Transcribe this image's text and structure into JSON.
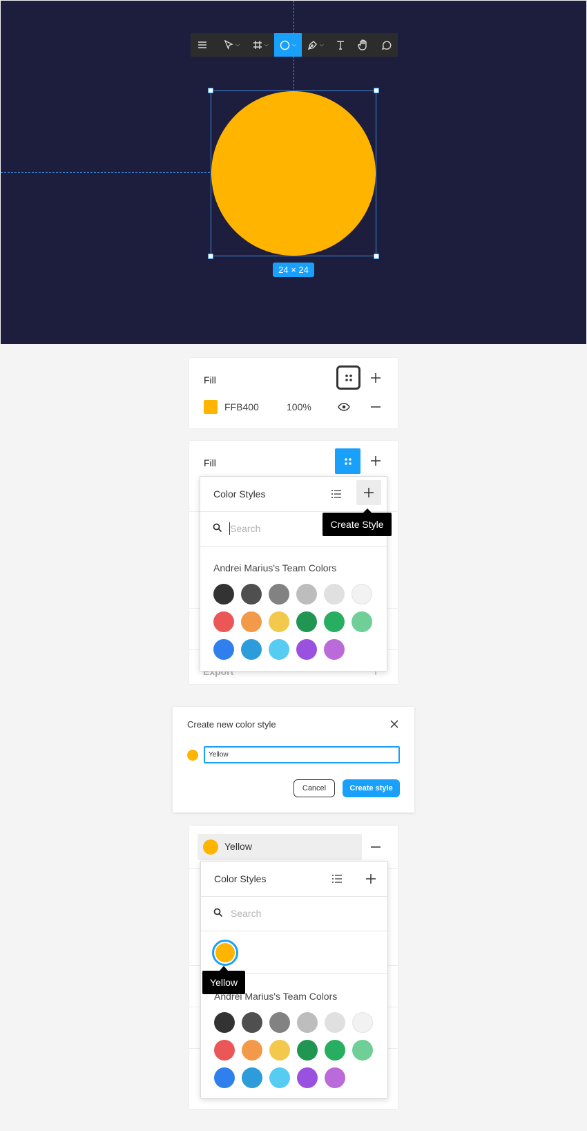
{
  "canvas": {
    "toolbar": {
      "tools": [
        {
          "name": "menu-icon"
        },
        {
          "name": "move-tool-icon"
        },
        {
          "name": "frame-tool-icon"
        },
        {
          "name": "ellipse-tool-icon",
          "active": true
        },
        {
          "name": "pen-tool-icon"
        },
        {
          "name": "text-tool-icon"
        },
        {
          "name": "hand-tool-icon"
        },
        {
          "name": "comment-tool-icon"
        }
      ]
    },
    "shape_fill": "#FFB400",
    "dimensions": "24 × 24"
  },
  "fill_panel_1": {
    "label": "Fill",
    "hex": "FFB400",
    "opacity": "100%"
  },
  "fill_panel_2": {
    "label": "Fill",
    "export_label": "Export",
    "popup": {
      "title": "Color Styles",
      "search_placeholder": "Search",
      "team_title": "Andrei Marius's Team Colors",
      "tooltip": "Create Style"
    }
  },
  "dialog": {
    "title": "Create new color style",
    "name_value": "Yellow",
    "cancel": "Cancel",
    "create": "Create style"
  },
  "fill_panel_3": {
    "style_name": "Yellow",
    "popup": {
      "title": "Color Styles",
      "search_placeholder": "Search",
      "team_title": "Andrei Marius's Team Colors",
      "tooltip": "Yellow"
    }
  },
  "team_colors": [
    "#333333",
    "#4f4f4f",
    "#828282",
    "#bdbdbd",
    "#e0e0e0",
    "#f2f2f2",
    "#eb5757",
    "#f2994a",
    "#f2c94c",
    "#219653",
    "#27ae60",
    "#6fcf97",
    "#2f80ed",
    "#2d9cdb",
    "#56ccf2",
    "#9b51e0",
    "#bb6bd9"
  ],
  "accent": "#18A0FB"
}
